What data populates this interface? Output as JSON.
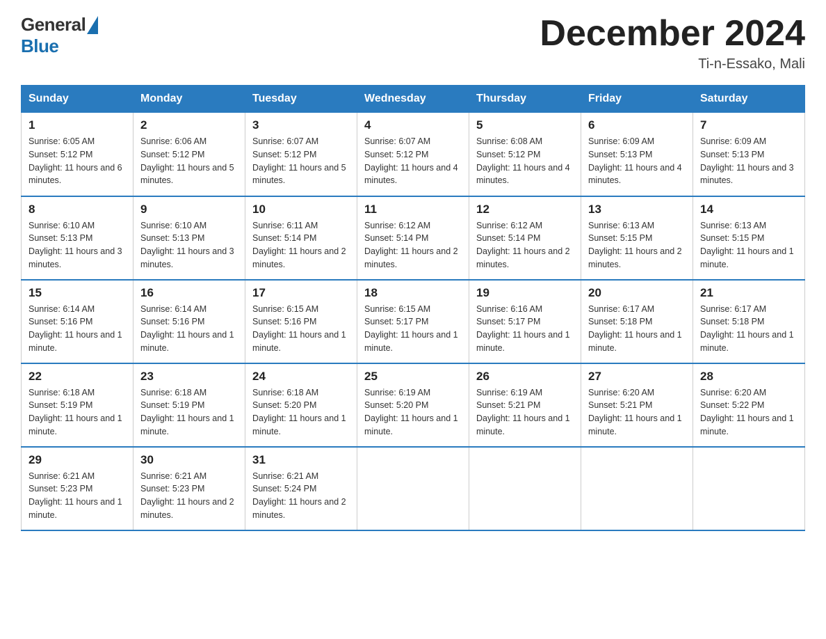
{
  "header": {
    "logo_general": "General",
    "logo_blue": "Blue",
    "title": "December 2024",
    "subtitle": "Ti-n-Essako, Mali"
  },
  "days_of_week": [
    "Sunday",
    "Monday",
    "Tuesday",
    "Wednesday",
    "Thursday",
    "Friday",
    "Saturday"
  ],
  "weeks": [
    [
      {
        "day": "1",
        "sunrise": "6:05 AM",
        "sunset": "5:12 PM",
        "daylight": "11 hours and 6 minutes."
      },
      {
        "day": "2",
        "sunrise": "6:06 AM",
        "sunset": "5:12 PM",
        "daylight": "11 hours and 5 minutes."
      },
      {
        "day": "3",
        "sunrise": "6:07 AM",
        "sunset": "5:12 PM",
        "daylight": "11 hours and 5 minutes."
      },
      {
        "day": "4",
        "sunrise": "6:07 AM",
        "sunset": "5:12 PM",
        "daylight": "11 hours and 4 minutes."
      },
      {
        "day": "5",
        "sunrise": "6:08 AM",
        "sunset": "5:12 PM",
        "daylight": "11 hours and 4 minutes."
      },
      {
        "day": "6",
        "sunrise": "6:09 AM",
        "sunset": "5:13 PM",
        "daylight": "11 hours and 4 minutes."
      },
      {
        "day": "7",
        "sunrise": "6:09 AM",
        "sunset": "5:13 PM",
        "daylight": "11 hours and 3 minutes."
      }
    ],
    [
      {
        "day": "8",
        "sunrise": "6:10 AM",
        "sunset": "5:13 PM",
        "daylight": "11 hours and 3 minutes."
      },
      {
        "day": "9",
        "sunrise": "6:10 AM",
        "sunset": "5:13 PM",
        "daylight": "11 hours and 3 minutes."
      },
      {
        "day": "10",
        "sunrise": "6:11 AM",
        "sunset": "5:14 PM",
        "daylight": "11 hours and 2 minutes."
      },
      {
        "day": "11",
        "sunrise": "6:12 AM",
        "sunset": "5:14 PM",
        "daylight": "11 hours and 2 minutes."
      },
      {
        "day": "12",
        "sunrise": "6:12 AM",
        "sunset": "5:14 PM",
        "daylight": "11 hours and 2 minutes."
      },
      {
        "day": "13",
        "sunrise": "6:13 AM",
        "sunset": "5:15 PM",
        "daylight": "11 hours and 2 minutes."
      },
      {
        "day": "14",
        "sunrise": "6:13 AM",
        "sunset": "5:15 PM",
        "daylight": "11 hours and 1 minute."
      }
    ],
    [
      {
        "day": "15",
        "sunrise": "6:14 AM",
        "sunset": "5:16 PM",
        "daylight": "11 hours and 1 minute."
      },
      {
        "day": "16",
        "sunrise": "6:14 AM",
        "sunset": "5:16 PM",
        "daylight": "11 hours and 1 minute."
      },
      {
        "day": "17",
        "sunrise": "6:15 AM",
        "sunset": "5:16 PM",
        "daylight": "11 hours and 1 minute."
      },
      {
        "day": "18",
        "sunrise": "6:15 AM",
        "sunset": "5:17 PM",
        "daylight": "11 hours and 1 minute."
      },
      {
        "day": "19",
        "sunrise": "6:16 AM",
        "sunset": "5:17 PM",
        "daylight": "11 hours and 1 minute."
      },
      {
        "day": "20",
        "sunrise": "6:17 AM",
        "sunset": "5:18 PM",
        "daylight": "11 hours and 1 minute."
      },
      {
        "day": "21",
        "sunrise": "6:17 AM",
        "sunset": "5:18 PM",
        "daylight": "11 hours and 1 minute."
      }
    ],
    [
      {
        "day": "22",
        "sunrise": "6:18 AM",
        "sunset": "5:19 PM",
        "daylight": "11 hours and 1 minute."
      },
      {
        "day": "23",
        "sunrise": "6:18 AM",
        "sunset": "5:19 PM",
        "daylight": "11 hours and 1 minute."
      },
      {
        "day": "24",
        "sunrise": "6:18 AM",
        "sunset": "5:20 PM",
        "daylight": "11 hours and 1 minute."
      },
      {
        "day": "25",
        "sunrise": "6:19 AM",
        "sunset": "5:20 PM",
        "daylight": "11 hours and 1 minute."
      },
      {
        "day": "26",
        "sunrise": "6:19 AM",
        "sunset": "5:21 PM",
        "daylight": "11 hours and 1 minute."
      },
      {
        "day": "27",
        "sunrise": "6:20 AM",
        "sunset": "5:21 PM",
        "daylight": "11 hours and 1 minute."
      },
      {
        "day": "28",
        "sunrise": "6:20 AM",
        "sunset": "5:22 PM",
        "daylight": "11 hours and 1 minute."
      }
    ],
    [
      {
        "day": "29",
        "sunrise": "6:21 AM",
        "sunset": "5:23 PM",
        "daylight": "11 hours and 1 minute."
      },
      {
        "day": "30",
        "sunrise": "6:21 AM",
        "sunset": "5:23 PM",
        "daylight": "11 hours and 2 minutes."
      },
      {
        "day": "31",
        "sunrise": "6:21 AM",
        "sunset": "5:24 PM",
        "daylight": "11 hours and 2 minutes."
      },
      null,
      null,
      null,
      null
    ]
  ],
  "labels": {
    "sunrise_prefix": "Sunrise: ",
    "sunset_prefix": "Sunset: ",
    "daylight_prefix": "Daylight: "
  }
}
